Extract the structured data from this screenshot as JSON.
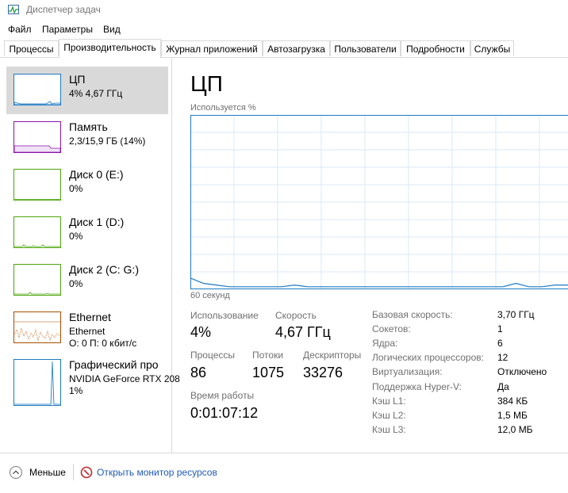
{
  "window": {
    "title": "Диспетчер задач"
  },
  "menu": [
    "Файл",
    "Параметры",
    "Вид"
  ],
  "tabs": [
    "Процессы",
    "Производительность",
    "Журнал приложений",
    "Автозагрузка",
    "Пользователи",
    "Подробности",
    "Службы"
  ],
  "active_tab": "Производительность",
  "resources": [
    {
      "name": "ЦП",
      "sub1": "4% 4,67 ГГц",
      "sub2": "",
      "color": "#1c7ac4",
      "selected": true
    },
    {
      "name": "Память",
      "sub1": "2,3/15,9 ГБ (14%)",
      "sub2": "",
      "color": "#8b12ae"
    },
    {
      "name": "Диск 0 (E:)",
      "sub1": "0%",
      "sub2": "",
      "color": "#4da60c"
    },
    {
      "name": "Диск 1 (D:)",
      "sub1": "0%",
      "sub2": "",
      "color": "#4da60c"
    },
    {
      "name": "Диск 2 (C: G:)",
      "sub1": "0%",
      "sub2": "",
      "color": "#4da60c"
    },
    {
      "name": "Ethernet",
      "sub1": "Ethernet",
      "sub2": "О: 0 П: 0 кбит/с",
      "color": "#a74f01"
    },
    {
      "name": "Графический про",
      "sub1": "NVIDIA GeForce RTX 208",
      "sub2": "1%",
      "color": "#1c7ac4"
    }
  ],
  "cpu": {
    "title": "ЦП",
    "graph_label": "Используется %",
    "graph_time": "60 секунд",
    "graph_color": "#1c7ac4",
    "usage_series": [
      6,
      3,
      2,
      1,
      1,
      1,
      1,
      1,
      2,
      1,
      1,
      1,
      1,
      1,
      1,
      1,
      1,
      1,
      1,
      1,
      1,
      1,
      1,
      1,
      1,
      3,
      1,
      1,
      2,
      2
    ],
    "stats": {
      "usage_label": "Использование",
      "usage_value": "4%",
      "speed_label": "Скорость",
      "speed_value": "4,67 ГГц",
      "processes_label": "Процессы",
      "processes_value": "86",
      "threads_label": "Потоки",
      "threads_value": "1075",
      "handles_label": "Дескрипторы",
      "handles_value": "33276",
      "uptime_label": "Время работы",
      "uptime_value": "0:01:07:12"
    },
    "details": [
      {
        "k": "Базовая скорость:",
        "v": "3,70 ГГц"
      },
      {
        "k": "Сокетов:",
        "v": "1"
      },
      {
        "k": "Ядра:",
        "v": "6"
      },
      {
        "k": "Логических процессоров:",
        "v": "12"
      },
      {
        "k": "Виртуализация:",
        "v": "Отключено"
      },
      {
        "k": "Поддержка Hyper-V:",
        "v": "Да"
      },
      {
        "k": "Кэш L1:",
        "v": "384 КБ"
      },
      {
        "k": "Кэш L2:",
        "v": "1,5 МБ"
      },
      {
        "k": "Кэш L3:",
        "v": "12,0 МБ"
      }
    ]
  },
  "bottom": {
    "less_label": "Меньше",
    "monitor_link": "Открыть монитор ресурсов"
  }
}
